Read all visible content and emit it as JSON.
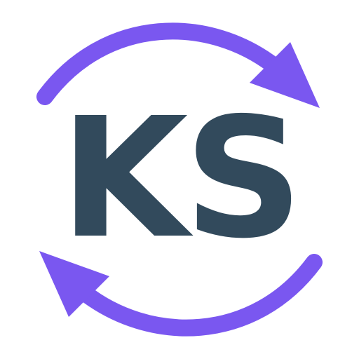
{
  "logo": {
    "monogram": "KS",
    "colors": {
      "text": "#324a5c",
      "arrows": "#7a57f0",
      "background": "#ffffff"
    },
    "icons": [
      "arrow-clockwise-top-icon",
      "arrow-clockwise-bottom-icon"
    ]
  }
}
